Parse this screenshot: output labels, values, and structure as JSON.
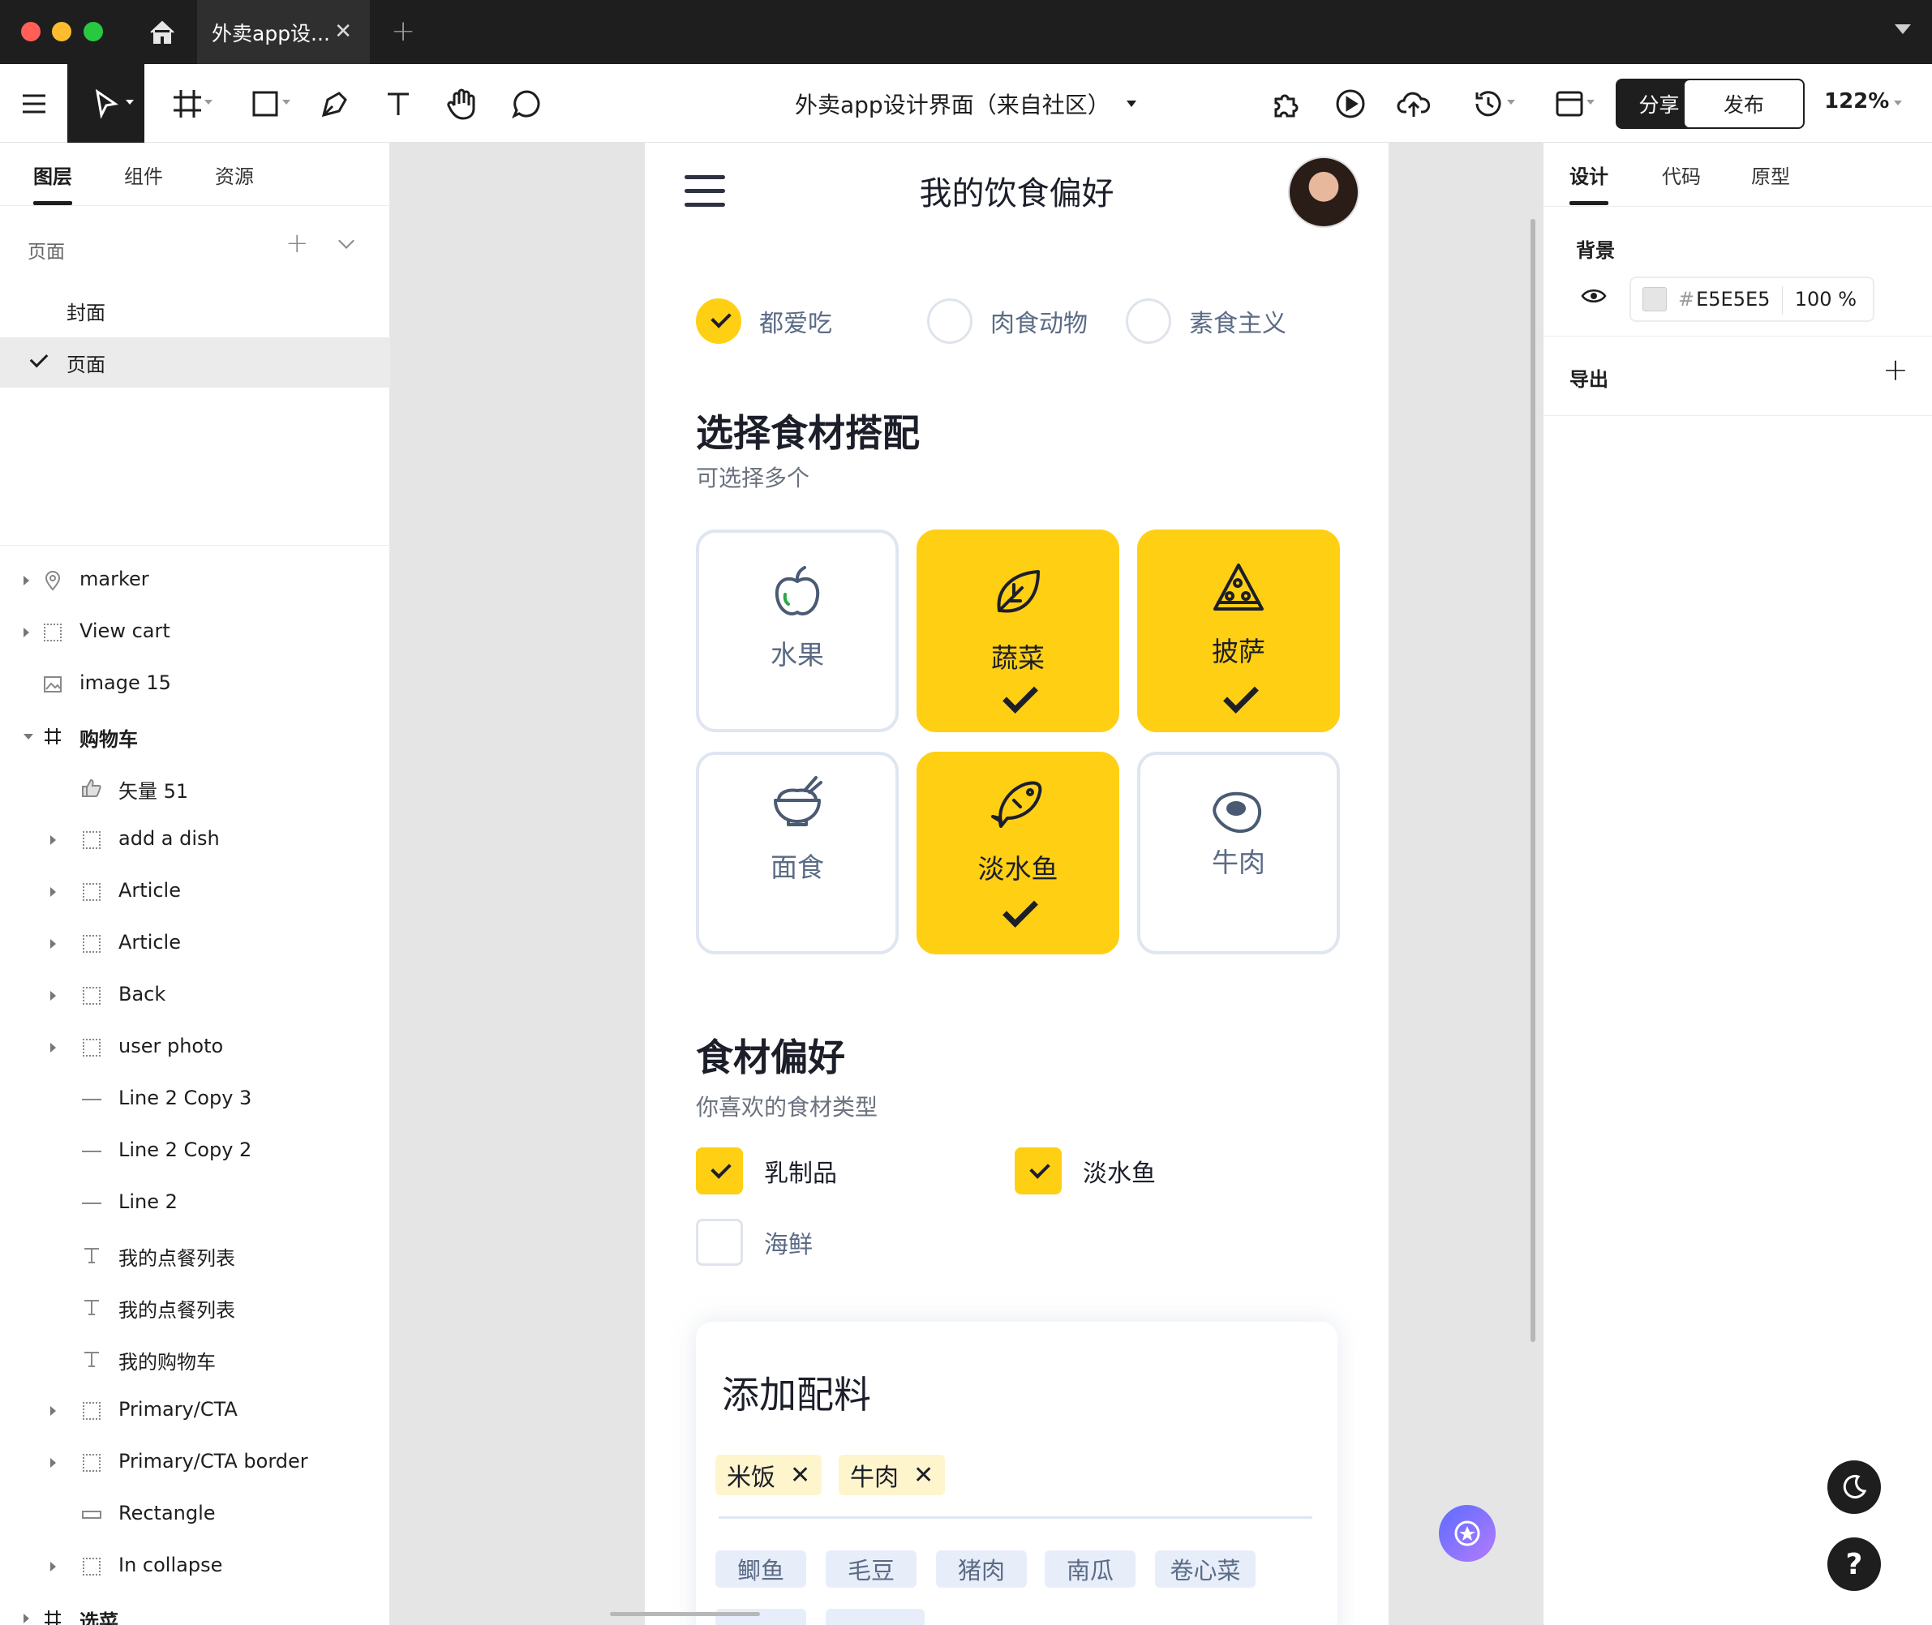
{
  "window": {
    "tab_title": "外卖app设...",
    "tab_close": "✕",
    "tab_add": "+"
  },
  "toolbar": {
    "doc_title": "外卖app设计界面（来自社区）",
    "share_label": "分享",
    "publish_label": "发布",
    "zoom": "122%",
    "tools": [
      "menu-icon",
      "move-icon",
      "frame-icon",
      "rectangle-icon",
      "pen-icon",
      "text-icon",
      "hand-icon",
      "comment-icon"
    ],
    "right_tools": [
      "plugin-icon",
      "play-icon",
      "upload-icon",
      "history-icon",
      "layout-icon"
    ]
  },
  "left_panel": {
    "tabs": [
      "图层",
      "组件",
      "资源"
    ],
    "pages_header": "页面",
    "pages": [
      {
        "label": "封面",
        "selected": false
      },
      {
        "label": "页面",
        "selected": true
      }
    ],
    "layers": [
      {
        "name": "marker",
        "icon": "marker-icon",
        "indent": 0,
        "arrow": "right"
      },
      {
        "name": "View cart",
        "icon": "frame-dotted-icon",
        "indent": 0,
        "arrow": "right"
      },
      {
        "name": "image 15",
        "icon": "image-icon",
        "indent": 0,
        "arrow": "none"
      },
      {
        "name": "购物车",
        "icon": "frame-icon",
        "indent": 0,
        "arrow": "down"
      },
      {
        "name": "矢量 51",
        "icon": "thumb-icon",
        "indent": 1,
        "arrow": "none"
      },
      {
        "name": "add a dish",
        "icon": "frame-dotted-icon",
        "indent": 1,
        "arrow": "right"
      },
      {
        "name": "Article",
        "icon": "frame-dotted-icon",
        "indent": 1,
        "arrow": "right"
      },
      {
        "name": "Article",
        "icon": "frame-dotted-icon",
        "indent": 1,
        "arrow": "right"
      },
      {
        "name": "Back",
        "icon": "frame-dotted-icon",
        "indent": 1,
        "arrow": "right"
      },
      {
        "name": "user photo",
        "icon": "frame-dotted-icon",
        "indent": 1,
        "arrow": "right"
      },
      {
        "name": "Line 2 Copy 3",
        "icon": "line-icon",
        "indent": 1,
        "arrow": "none"
      },
      {
        "name": "Line 2 Copy 2",
        "icon": "line-icon",
        "indent": 1,
        "arrow": "none"
      },
      {
        "name": "Line 2",
        "icon": "line-icon",
        "indent": 1,
        "arrow": "none"
      },
      {
        "name": "我的点餐列表",
        "icon": "text-icon",
        "indent": 1,
        "arrow": "none"
      },
      {
        "name": "我的点餐列表",
        "icon": "text-icon",
        "indent": 1,
        "arrow": "none"
      },
      {
        "name": "我的购物车",
        "icon": "text-icon",
        "indent": 1,
        "arrow": "none"
      },
      {
        "name": "Primary/CTA",
        "icon": "frame-dotted-icon",
        "indent": 1,
        "arrow": "right"
      },
      {
        "name": "Primary/CTA border",
        "icon": "frame-dotted-icon",
        "indent": 1,
        "arrow": "right"
      },
      {
        "name": "Rectangle",
        "icon": "rectangle-icon",
        "indent": 1,
        "arrow": "none"
      },
      {
        "name": "In collapse",
        "icon": "frame-dotted-icon",
        "indent": 1,
        "arrow": "right"
      },
      {
        "name": "选菜",
        "icon": "frame-icon",
        "indent": 0,
        "arrow": "right"
      }
    ]
  },
  "phone": {
    "title": "我的饮食偏好",
    "diet_options": [
      {
        "label": "都爱吃",
        "selected": true
      },
      {
        "label": "肉食动物",
        "selected": false
      },
      {
        "label": "素食主义",
        "selected": false
      }
    ],
    "ingredients_section": {
      "title": "选择食材搭配",
      "subtitle": "可选择多个",
      "tiles": [
        {
          "label": "水果",
          "icon": "apple-icon",
          "selected": false
        },
        {
          "label": "蔬菜",
          "icon": "leaf-icon",
          "selected": true
        },
        {
          "label": "披萨",
          "icon": "pizza-icon",
          "selected": true
        },
        {
          "label": "面食",
          "icon": "noodle-bowl-icon",
          "selected": false
        },
        {
          "label": "淡水鱼",
          "icon": "fish-icon",
          "selected": true
        },
        {
          "label": "牛肉",
          "icon": "steak-icon",
          "selected": false
        }
      ]
    },
    "preference_section": {
      "title": "食材偏好",
      "subtitle": "你喜欢的食材类型",
      "checkboxes": [
        {
          "label": "乳制品",
          "checked": true
        },
        {
          "label": "淡水鱼",
          "checked": true
        },
        {
          "label": "海鲜",
          "checked": false
        }
      ]
    },
    "toppings_card": {
      "title": "添加配料",
      "selected_chips": [
        "米饭",
        "牛肉"
      ],
      "chip_remove": "✕",
      "options": [
        "鲫鱼",
        "毛豆",
        "猪肉",
        "南瓜",
        "卷心菜"
      ]
    }
  },
  "right_panel": {
    "tabs": [
      "设计",
      "代码",
      "原型"
    ],
    "background_label": "背景",
    "color_hash": "#",
    "color_hex": "E5E5E5",
    "opacity": "100 %",
    "export_label": "导出",
    "export_add": "+",
    "dark_mode_icon": "moon-icon",
    "help_label": "?"
  },
  "colors": {
    "accent_yellow": "#FFCF14",
    "canvas_bg": "#E5E5E5",
    "text_dark": "#1C1F2A",
    "text_muted": "#5B6B85"
  }
}
